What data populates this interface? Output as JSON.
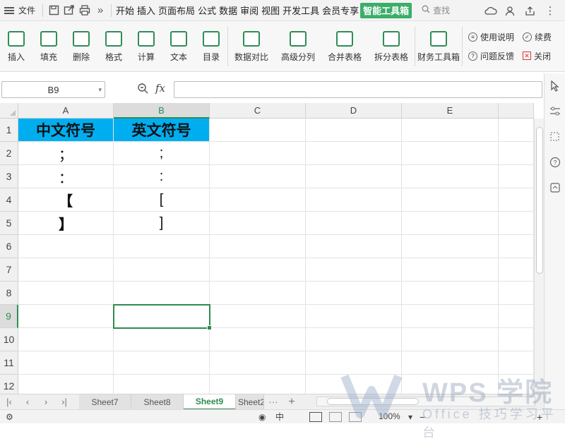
{
  "menubar": {
    "file_label": "文件",
    "tabs": [
      "开始",
      "插入",
      "页面布局",
      "公式",
      "数据",
      "审阅",
      "视图",
      "开发工具",
      "会员专享"
    ],
    "active_tab": "智能工具箱",
    "search_label": "查找"
  },
  "ribbon": {
    "buttons": [
      {
        "label": "插入",
        "icon": "insert-icon"
      },
      {
        "label": "填充",
        "icon": "fill-icon"
      },
      {
        "label": "删除",
        "icon": "delete-icon"
      },
      {
        "label": "格式",
        "icon": "format-icon"
      },
      {
        "label": "计算",
        "icon": "calculate-icon"
      },
      {
        "label": "文本",
        "icon": "text-icon"
      },
      {
        "label": "目录",
        "icon": "toc-icon"
      }
    ],
    "buttons2": [
      {
        "label": "数据对比",
        "icon": "data-compare-icon"
      },
      {
        "label": "高级分列",
        "icon": "split-column-icon"
      },
      {
        "label": "合并表格",
        "icon": "merge-table-icon"
      },
      {
        "label": "拆分表格",
        "icon": "split-table-icon"
      }
    ],
    "finance_label": "财务工具箱",
    "help_label": "使用说明",
    "feedback_label": "问题反馈",
    "renew_label": "续费",
    "close_label": "关闭"
  },
  "formula_bar": {
    "name_box": "B9",
    "fx_label": "fx",
    "formula": ""
  },
  "grid": {
    "columns": [
      "A",
      "B",
      "C",
      "D",
      "E"
    ],
    "rows": [
      "1",
      "2",
      "3",
      "4",
      "5",
      "6",
      "7",
      "8",
      "9",
      "10",
      "11",
      "12"
    ],
    "selected_col": "B",
    "selected_row": "9",
    "header_row": [
      "中文符号",
      "英文符号"
    ],
    "data": [
      [
        "；",
        ";"
      ],
      [
        "：",
        ":"
      ],
      [
        "【",
        "["
      ],
      [
        "】",
        "]"
      ]
    ]
  },
  "sheets": {
    "tabs": [
      "Sheet7",
      "Sheet8",
      "Sheet9",
      "Sheet2"
    ],
    "active": "Sheet9"
  },
  "statusbar": {
    "zoom": "100%"
  },
  "watermark": {
    "title": "WPS 学院",
    "subtitle": "Office 技巧学习平台"
  }
}
